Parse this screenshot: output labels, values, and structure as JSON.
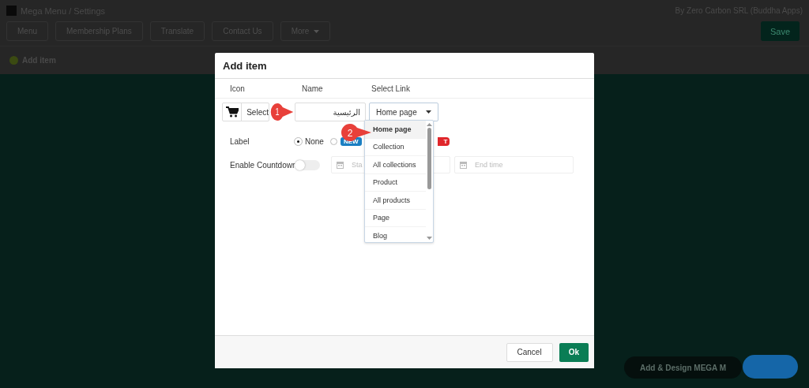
{
  "app": {
    "title": "Mega Menu / Settings",
    "credit": "By Zero Carbon SRL (Buddha Apps)",
    "save_button": "Save",
    "add_item_button": "Add item",
    "tabs": [
      {
        "label": "Menu",
        "dropdown": false
      },
      {
        "label": "Membership Plans",
        "dropdown": false
      },
      {
        "label": "Translate",
        "dropdown": false
      },
      {
        "label": "Contact Us",
        "dropdown": false
      },
      {
        "label": "More",
        "dropdown": true
      }
    ]
  },
  "dialog": {
    "title": "Add item",
    "columns": [
      "Icon",
      "Name",
      "Select Link"
    ],
    "icon_button": "Select",
    "name_value": "الرئيسية",
    "link_select": {
      "value": "Home page",
      "options": [
        {
          "label": "Home page",
          "selected": true
        },
        {
          "label": "Collection",
          "selected": false
        },
        {
          "label": "All collections",
          "selected": false
        },
        {
          "label": "Product",
          "selected": false
        },
        {
          "label": "All products",
          "selected": false
        },
        {
          "label": "Page",
          "selected": false
        },
        {
          "label": "Blog",
          "selected": false
        }
      ]
    },
    "label_row": {
      "label": "Label",
      "options": [
        {
          "kind": "text",
          "text": "None",
          "selected": true
        },
        {
          "kind": "badge",
          "text": "NEW",
          "color": "#1b7fc2",
          "selected": false
        }
      ],
      "partial_badge": {
        "text": "T",
        "color": "#e0262b"
      }
    },
    "countdown": {
      "label": "Enable Countdown",
      "on": false,
      "start_placeholder": "Sta",
      "end_placeholder": "End time"
    },
    "cancel_button": "Cancel",
    "ok_button": "Ok",
    "callouts": [
      {
        "text": "1"
      },
      {
        "text": "2"
      }
    ]
  },
  "promo_button": "Add & Design MEGA M"
}
